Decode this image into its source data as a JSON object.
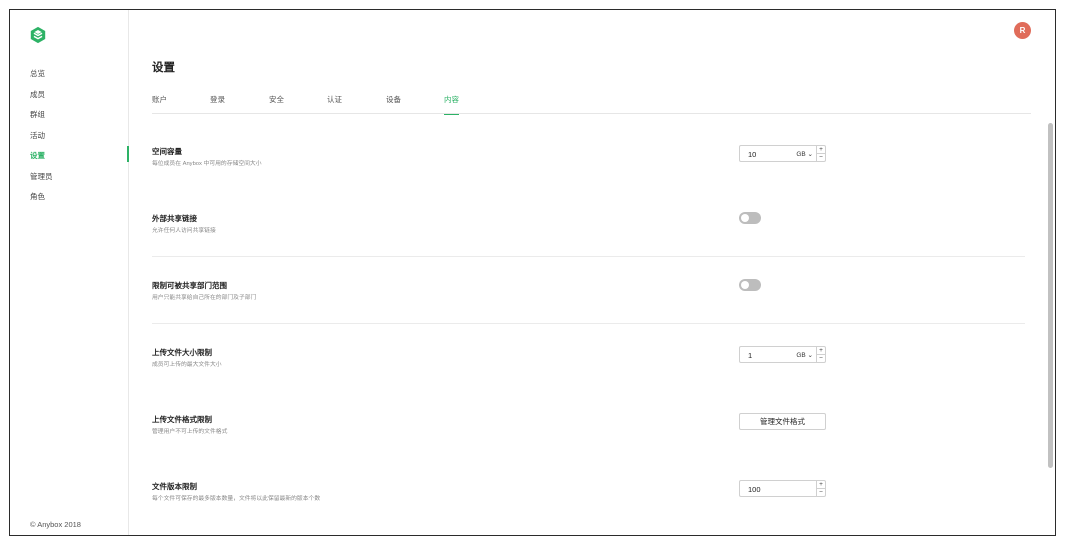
{
  "sidebar": {
    "items": [
      {
        "label": "总览"
      },
      {
        "label": "成员"
      },
      {
        "label": "群组"
      },
      {
        "label": "活动"
      },
      {
        "label": "设置"
      },
      {
        "label": "管理员"
      },
      {
        "label": "角色"
      }
    ],
    "active_index": 4,
    "copyright": "© Anybox 2018"
  },
  "header": {
    "avatar_initial": "R",
    "title": "设置"
  },
  "tabs": [
    {
      "label": "账户"
    },
    {
      "label": "登录"
    },
    {
      "label": "安全"
    },
    {
      "label": "认证"
    },
    {
      "label": "设备"
    },
    {
      "label": "内容"
    }
  ],
  "active_tab": 5,
  "settings": {
    "storage": {
      "title": "空间容量",
      "desc": "每位成员在 Anybox 中可用的存储空间大小",
      "value": "10",
      "unit": "GB",
      "spin_up": "+",
      "spin_down": "−"
    },
    "external_share": {
      "title": "外部共享链接",
      "desc": "允许任何人访问共享链接",
      "enabled": false
    },
    "restrict_share": {
      "title": "限制可被共享部门范围",
      "desc": "用户只能共享给自己所在的部门及子部门",
      "enabled": false
    },
    "upload_size": {
      "title": "上传文件大小限制",
      "desc": "成员可上传的最大文件大小",
      "value": "1",
      "unit": "GB",
      "spin_up": "+",
      "spin_down": "−"
    },
    "upload_format": {
      "title": "上传文件格式限制",
      "desc": "管理用户不可上传的文件格式",
      "button": "管理文件格式"
    },
    "version_limit": {
      "title": "文件版本限制",
      "desc": "每个文件可保存的最多版本数量，文件将以此保留最新的版本个数",
      "value": "100",
      "spin_up": "+",
      "spin_down": "−"
    }
  },
  "colors": {
    "accent": "#2db266",
    "avatar": "#e06c5a",
    "toggle_off": "#bdbdbd"
  }
}
